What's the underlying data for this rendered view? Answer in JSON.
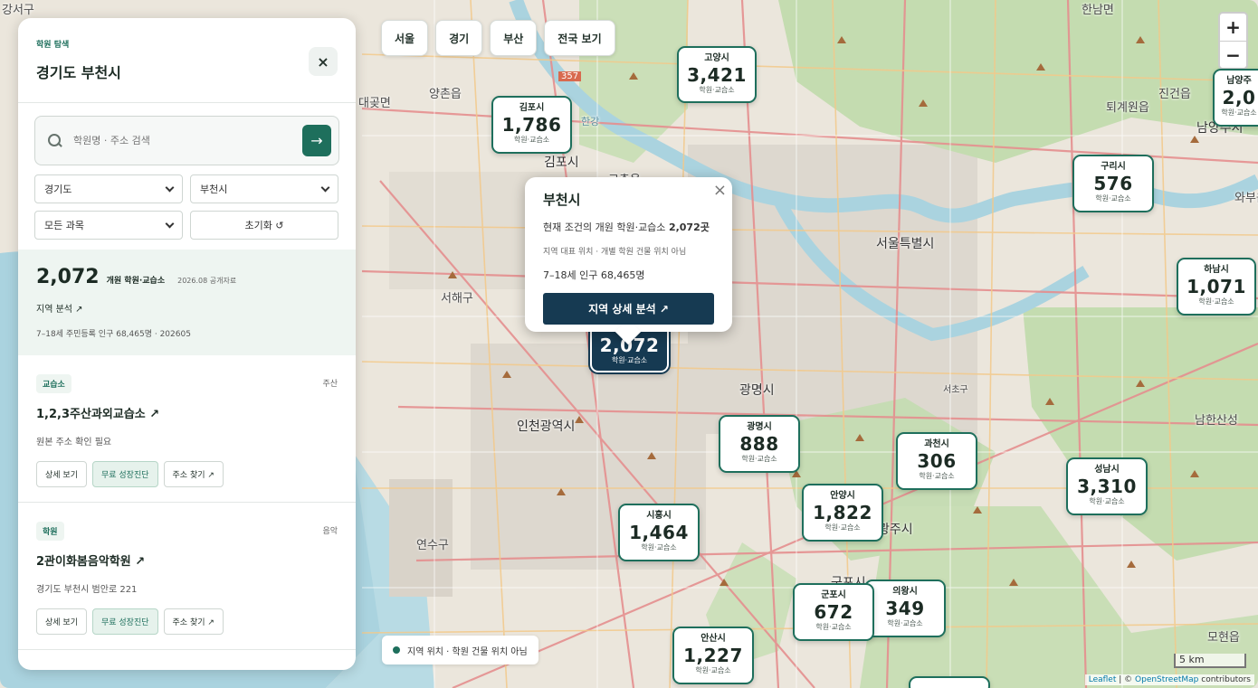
{
  "map": {
    "labels": [
      "강서구",
      "한남면",
      "대곶면",
      "양촌읍",
      "김포시",
      "고촌읍",
      "서울특별시",
      "서해구",
      "광명시",
      "인천광역시",
      "연수구",
      "남한산성",
      "퇴계원읍",
      "진건읍",
      "남양주시",
      "와부읍",
      "모현읍",
      "군포시",
      "357",
      "한강",
      "서초구",
      "광주시"
    ],
    "region_chips": [
      "서울",
      "경기",
      "부산",
      "전국 보기"
    ],
    "zoom_in": "+",
    "zoom_out": "−",
    "sub_label": "학원·교습소",
    "markers": [
      {
        "name": "김포시",
        "count": "1,786"
      },
      {
        "name": "고양시",
        "count": "3,421"
      },
      {
        "name": "남양주",
        "count": "2,0"
      },
      {
        "name": "구리시",
        "count": "576"
      },
      {
        "name": "하남시",
        "count": "1,071"
      },
      {
        "name": "부천시",
        "count": "2,072"
      },
      {
        "name": "광명시",
        "count": "888"
      },
      {
        "name": "과천시",
        "count": "306"
      },
      {
        "name": "성남시",
        "count": "3,310"
      },
      {
        "name": "안양시",
        "count": "1,822"
      },
      {
        "name": "시흥시",
        "count": "1,464"
      },
      {
        "name": "군포시",
        "count": "672"
      },
      {
        "name": "의왕시",
        "count": "349"
      },
      {
        "name": "안산시",
        "count": "1,227"
      }
    ],
    "legend": "지역 위치 · 학원 건물 위치 아님",
    "scale": "5 km",
    "attribution": {
      "leaflet": "Leaflet",
      "sep": " | © ",
      "osm": "OpenStreetMap",
      "tail": " contributors"
    }
  },
  "popup": {
    "title": "부천시",
    "line_prefix": "현재 조건의 개원 학원·교습소 ",
    "line_count": "2,072곳",
    "note": "지역 대표 위치 · 개별 학원 건물 위치 아님",
    "population": "7–18세 인구 68,465명",
    "button": "지역 상세 분석 ↗",
    "close": "×"
  },
  "panel": {
    "eyebrow": "학원 탐색",
    "title": "경기도 부천시",
    "close": "×",
    "search_placeholder": "학원명 · 주소 검색",
    "search_go": "→",
    "filters": {
      "province": "경기도",
      "city": "부천시",
      "subject": "모든 과목",
      "reset": "초기화 ↺"
    },
    "stats": {
      "count": "2,072",
      "label": "개원 학원·교습소",
      "date": "2026.08 공개자료",
      "link": "지역 분석 ↗",
      "population": "7–18세 주민등록 인구 68,465명 · 202605"
    },
    "cards": [
      {
        "tag": "교습소",
        "subject": "주산",
        "name": "1,2,3주산과외교습소 ↗",
        "addr": "원본 주소 확인 필요",
        "btn_detail": "상세 보기",
        "btn_diag": "무료 성장진단",
        "btn_addr": "주소 찾기 ↗"
      },
      {
        "tag": "학원",
        "subject": "음악",
        "name": "2관이화봄음악학원 ↗",
        "addr": "경기도 부천시 범안로 221",
        "btn_detail": "상세 보기",
        "btn_diag": "무료 성장진단",
        "btn_addr": "주소 찾기 ↗"
      }
    ]
  },
  "colors": {
    "accent": "#1e6f5c",
    "navy": "#163a52",
    "panel_stats_bg": "#eef5f1"
  }
}
